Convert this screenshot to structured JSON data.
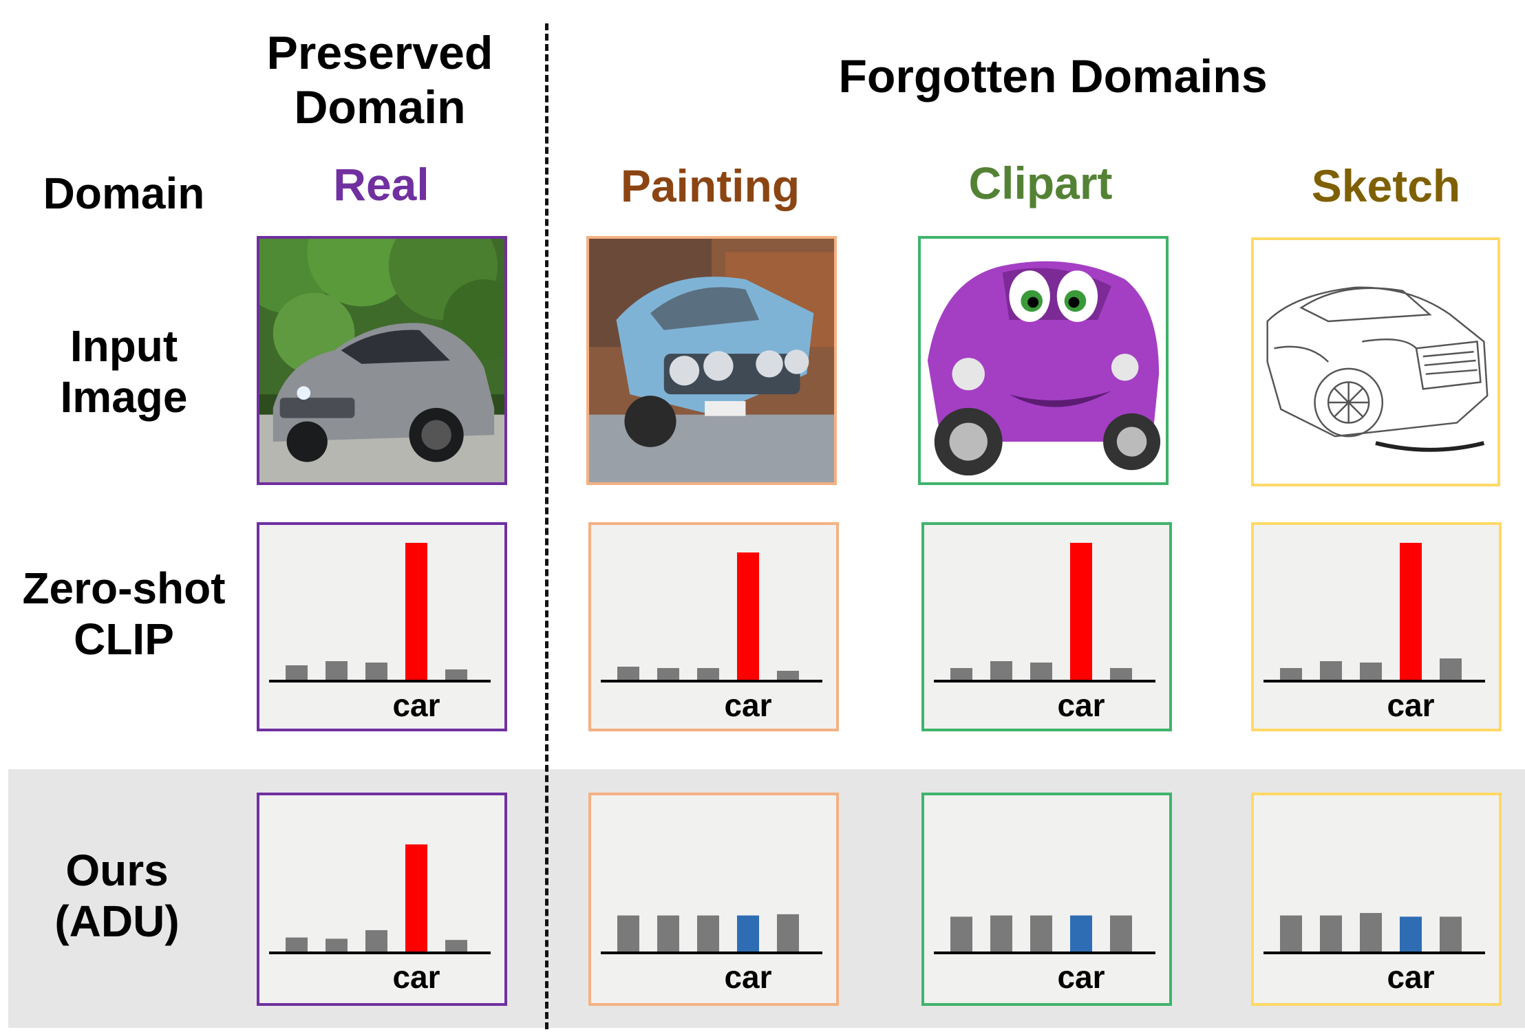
{
  "headers": {
    "preserved": "Preserved\nDomain",
    "forgotten": "Forgotten Domains",
    "domain_row": "Domain"
  },
  "row_labels": {
    "input": "Input\nImage",
    "zeroshot": "Zero-shot\nCLIP",
    "ours": "Ours\n(ADU)"
  },
  "colors": {
    "target_bar": "#ff0000",
    "forgotten_target_bar": "#2e6db4",
    "other_bar": "#7a7a7a",
    "panel_bg": "#f1f1f0",
    "ours_band": "#e6e6e6"
  },
  "domains": [
    {
      "name": "Real",
      "color": "#7030a0",
      "image_icon": "real-car-photo-icon"
    },
    {
      "name": "Painting",
      "color": "#8b4513",
      "image_icon": "painted-car-icon"
    },
    {
      "name": "Clipart",
      "color": "#548235",
      "image_icon": "clipart-car-icon"
    },
    {
      "name": "Sketch",
      "color": "#7f6000",
      "image_icon": "sketch-car-icon"
    }
  ],
  "chart_data": [
    {
      "type": "bar",
      "row": "Zero-shot CLIP",
      "domain": "Real",
      "target_label": "car",
      "target_index": 3,
      "values": [
        0.11,
        0.14,
        0.13,
        1.0,
        0.08
      ]
    },
    {
      "type": "bar",
      "row": "Zero-shot CLIP",
      "domain": "Painting",
      "target_label": "car",
      "target_index": 3,
      "values": [
        0.1,
        0.09,
        0.09,
        0.93,
        0.07
      ]
    },
    {
      "type": "bar",
      "row": "Zero-shot CLIP",
      "domain": "Clipart",
      "target_label": "car",
      "target_index": 3,
      "values": [
        0.09,
        0.14,
        0.13,
        1.0,
        0.09
      ]
    },
    {
      "type": "bar",
      "row": "Zero-shot CLIP",
      "domain": "Sketch",
      "target_label": "car",
      "target_index": 3,
      "values": [
        0.09,
        0.14,
        0.13,
        1.0,
        0.16
      ]
    },
    {
      "type": "bar",
      "row": "Ours (ADU)",
      "domain": "Real",
      "target_label": "car",
      "target_index": 3,
      "values": [
        0.12,
        0.11,
        0.18,
        0.88,
        0.1
      ]
    },
    {
      "type": "bar",
      "row": "Ours (ADU)",
      "domain": "Painting",
      "target_label": "car",
      "target_index": 3,
      "values": [
        0.3,
        0.3,
        0.3,
        0.3,
        0.31
      ]
    },
    {
      "type": "bar",
      "row": "Ours (ADU)",
      "domain": "Clipart",
      "target_label": "car",
      "target_index": 3,
      "values": [
        0.29,
        0.3,
        0.3,
        0.3,
        0.3
      ]
    },
    {
      "type": "bar",
      "row": "Ours (ADU)",
      "domain": "Sketch",
      "target_label": "car",
      "target_index": 3,
      "values": [
        0.3,
        0.3,
        0.32,
        0.29,
        0.29
      ]
    }
  ]
}
